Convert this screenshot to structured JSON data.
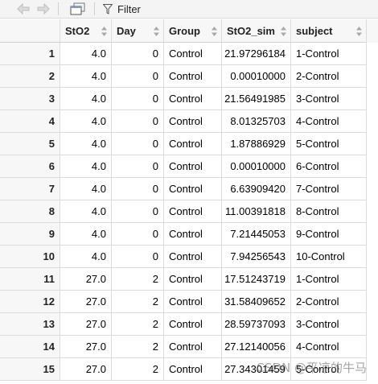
{
  "toolbar": {
    "back_icon": "arrow-left-icon",
    "forward_icon": "arrow-right-icon",
    "popout_icon": "popout-window-icon",
    "filter_icon": "filter-funnel-icon",
    "filter_label": "Filter"
  },
  "table": {
    "columns": [
      {
        "label": "",
        "align": "num"
      },
      {
        "label": "StO2",
        "align": "num"
      },
      {
        "label": "Day",
        "align": "num"
      },
      {
        "label": "Group",
        "align": "txt"
      },
      {
        "label": "StO2_sim",
        "align": "num"
      },
      {
        "label": "subject",
        "align": "txt"
      }
    ],
    "rows": [
      [
        "1",
        "4.0",
        "0",
        "Control",
        "21.97296184",
        "1-Control"
      ],
      [
        "2",
        "4.0",
        "0",
        "Control",
        "0.00010000",
        "2-Control"
      ],
      [
        "3",
        "4.0",
        "0",
        "Control",
        "21.56491985",
        "3-Control"
      ],
      [
        "4",
        "4.0",
        "0",
        "Control",
        "8.01325703",
        "4-Control"
      ],
      [
        "5",
        "4.0",
        "0",
        "Control",
        "1.87886929",
        "5-Control"
      ],
      [
        "6",
        "4.0",
        "0",
        "Control",
        "0.00010000",
        "6-Control"
      ],
      [
        "7",
        "4.0",
        "0",
        "Control",
        "6.63909420",
        "7-Control"
      ],
      [
        "8",
        "4.0",
        "0",
        "Control",
        "11.00391818",
        "8-Control"
      ],
      [
        "9",
        "4.0",
        "0",
        "Control",
        "7.21445053",
        "9-Control"
      ],
      [
        "10",
        "4.0",
        "0",
        "Control",
        "7.94256543",
        "10-Control"
      ],
      [
        "11",
        "27.0",
        "2",
        "Control",
        "17.51243719",
        "1-Control"
      ],
      [
        "12",
        "27.0",
        "2",
        "Control",
        "31.58409652",
        "2-Control"
      ],
      [
        "13",
        "27.0",
        "2",
        "Control",
        "28.59737093",
        "3-Control"
      ],
      [
        "14",
        "27.0",
        "2",
        "Control",
        "27.12140056",
        "4-Control"
      ],
      [
        "15",
        "27.0",
        "2",
        "Control",
        "27.34301459",
        "5-Control"
      ]
    ]
  },
  "watermark": "CSDN @平凉的牛马"
}
